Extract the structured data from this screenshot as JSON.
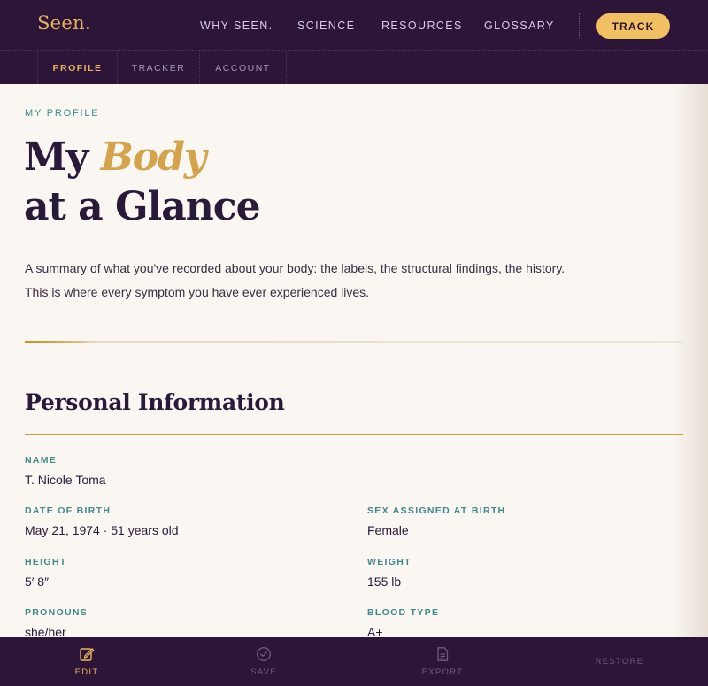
{
  "brand": {
    "logo": "Seen."
  },
  "nav": {
    "links": [
      "WHY SEEN.",
      "SCIENCE",
      "RESOURCES",
      "GLOSSARY"
    ],
    "cta": "TRACK"
  },
  "subnav": {
    "tabs": [
      "PROFILE",
      "TRACKER",
      "ACCOUNT"
    ],
    "active": "PROFILE"
  },
  "page": {
    "eyebrow": "MY PROFILE",
    "title_line1_plain": "My ",
    "title_line1_accent": "Body",
    "title_line2": "at a Glance",
    "lead": "A summary of what you've recorded about your body: the labels, the structural findings, the history. This is where every symptom you have ever experienced lives."
  },
  "personal_info": {
    "heading": "Personal Information",
    "fields": {
      "name": {
        "label": "NAME",
        "value": "T. Nicole Toma"
      },
      "dob": {
        "label": "DATE OF BIRTH",
        "value": "May 21, 1974 · 51 years old"
      },
      "sex": {
        "label": "SEX ASSIGNED AT BIRTH",
        "value": "Female"
      },
      "height": {
        "label": "HEIGHT",
        "value": "5′ 8″"
      },
      "weight": {
        "label": "WEIGHT",
        "value": "155 lb"
      },
      "pronouns": {
        "label": "PRONOUNS",
        "value": "she/her"
      },
      "blood": {
        "label": "BLOOD TYPE",
        "value": "A+"
      }
    }
  },
  "toolbar": {
    "edit": "EDIT",
    "save": "SAVE",
    "export": "EXPORT",
    "restore": "RESTORE"
  },
  "colors": {
    "nav_bg": "#2c1538",
    "gold": "#e6b45c",
    "teal": "#3e8a8a",
    "ink": "#2a1a3a",
    "paper": "#faf6f1"
  }
}
